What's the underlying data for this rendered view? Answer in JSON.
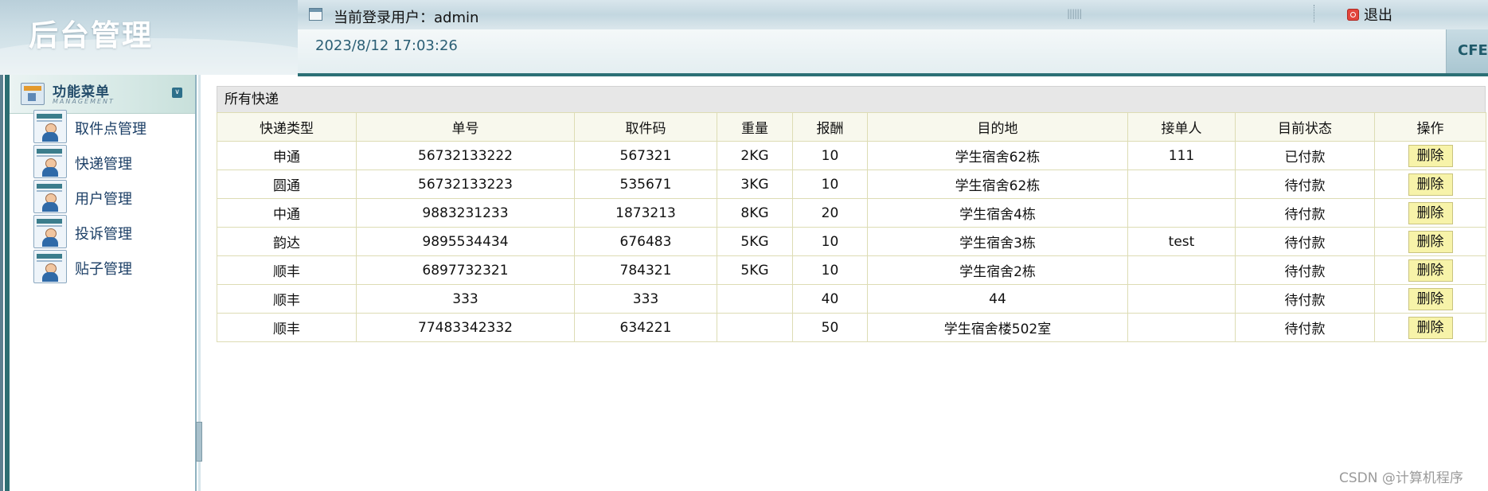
{
  "header": {
    "title": "后台管理",
    "current_user": "当前登录用户：admin",
    "logout_label": "退出",
    "datetime": "2023/8/12 17:03:26",
    "brand_fragment": "CFE"
  },
  "sidebar": {
    "menu_title": "功能菜单",
    "menu_subtitle": "MANAGEMENT",
    "items": [
      {
        "label": "取件点管理"
      },
      {
        "label": "快递管理"
      },
      {
        "label": "用户管理"
      },
      {
        "label": "投诉管理"
      },
      {
        "label": "贴子管理"
      }
    ]
  },
  "main": {
    "panel_title": "所有快递",
    "columns": [
      "快递类型",
      "单号",
      "取件码",
      "重量",
      "报酬",
      "目的地",
      "接单人",
      "目前状态",
      "操作"
    ],
    "rows": [
      [
        "申通",
        "56732133222",
        "567321",
        "2KG",
        "10",
        "学生宿舍62栋",
        "111",
        "已付款",
        "删除"
      ],
      [
        "圆通",
        "56732133223",
        "535671",
        "3KG",
        "10",
        "学生宿舍62栋",
        "",
        "待付款",
        "删除"
      ],
      [
        "中通",
        "9883231233",
        "1873213",
        "8KG",
        "20",
        "学生宿舍4栋",
        "",
        "待付款",
        "删除"
      ],
      [
        "韵达",
        "9895534434",
        "676483",
        "5KG",
        "10",
        "学生宿舍3栋",
        "test",
        "待付款",
        "删除"
      ],
      [
        "顺丰",
        "6897732321",
        "784321",
        "5KG",
        "10",
        "学生宿舍2栋",
        "",
        "待付款",
        "删除"
      ],
      [
        "顺丰",
        "333",
        "333",
        "",
        "40",
        "44",
        "",
        "待付款",
        "删除"
      ],
      [
        "顺丰",
        "77483342332",
        "634221",
        "",
        "50",
        "学生宿舍楼502室",
        "",
        "待付款",
        "删除"
      ]
    ]
  },
  "watermark": "CSDN @计算机程序",
  "colors": {
    "accent": "#2b6f75",
    "table_border": "#dddcb4",
    "header_row": "#f8f8ed",
    "delete_button": "#f7f3a9"
  }
}
